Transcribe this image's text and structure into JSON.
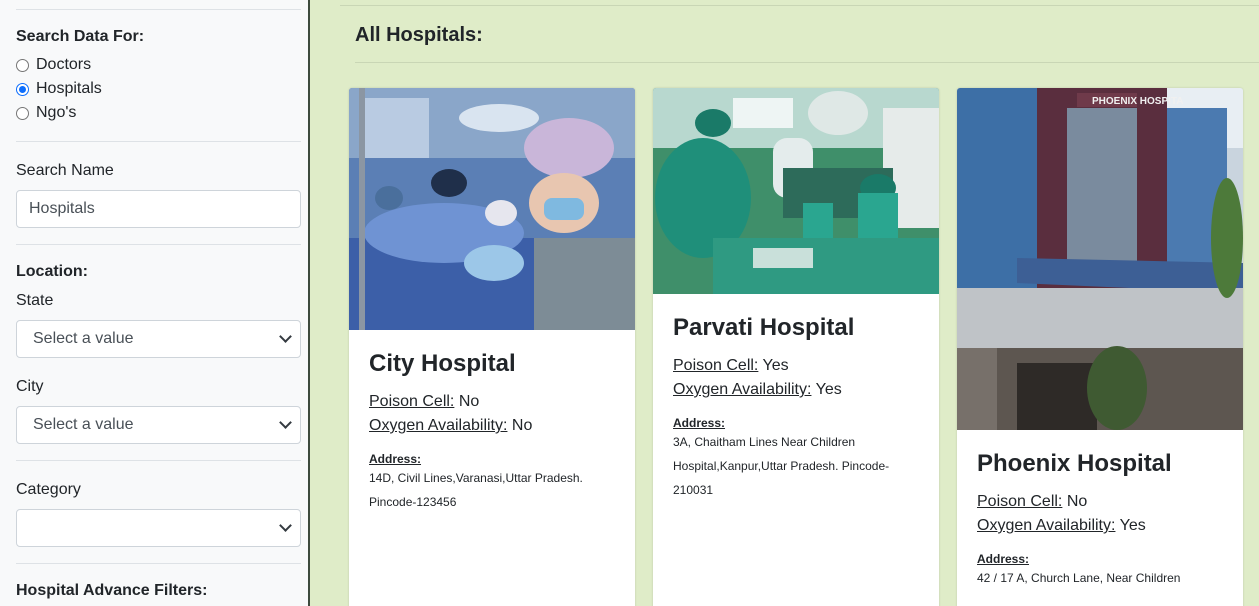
{
  "sidebar": {
    "search_for_title": "Search Data For:",
    "options": [
      {
        "label": "Doctors",
        "checked": false
      },
      {
        "label": "Hospitals",
        "checked": true
      },
      {
        "label": "Ngo's",
        "checked": false
      }
    ],
    "search_name_label": "Search Name",
    "search_name_value": "Hospitals",
    "location_title": "Location:",
    "state_label": "State",
    "state_value": "Select a value",
    "city_label": "City",
    "city_value": "Select a value",
    "category_label": "Category",
    "category_value": "",
    "advance_filters_title": "Hospital Advance Filters:"
  },
  "main": {
    "title": "All Hospitals:",
    "cards": [
      {
        "name": "City Hospital",
        "poison_label": "Poison Cell:",
        "poison_value": "No",
        "oxygen_label": "Oxygen Availability:",
        "oxygen_value": "No",
        "address_label": "Address:",
        "address": "14D, Civil Lines,Varanasi,Uttar Pradesh. Pincode-123456"
      },
      {
        "name": "Parvati Hospital",
        "poison_label": "Poison Cell:",
        "poison_value": "Yes",
        "oxygen_label": "Oxygen Availability:",
        "oxygen_value": "Yes",
        "address_label": "Address:",
        "address": "3A, Chaitham Lines Near Children Hospital,Kanpur,Uttar Pradesh. Pincode-210031"
      },
      {
        "name": "Phoenix Hospital",
        "poison_label": "Poison Cell:",
        "poison_value": "No",
        "oxygen_label": "Oxygen Availability:",
        "oxygen_value": "Yes",
        "address_label": "Address:",
        "address": "42 / 17 A, Church Lane, Near Children",
        "photo_sign": "PHOENIX HOSPITA"
      }
    ]
  }
}
